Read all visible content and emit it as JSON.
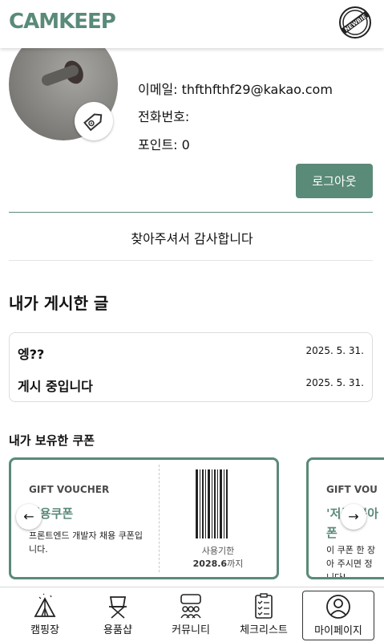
{
  "header": {
    "logo": "CAMKEEP",
    "badge_text": "NEWBIE",
    "badge_icon": "newbie-stamp-icon"
  },
  "profile": {
    "avatar_icon": "cat-paw-photo",
    "edit_icon": "tag-icon",
    "email_label": "이메일: thfthfthf29@kakao.com",
    "phone_label": "전화번호:",
    "points_label": "포인트: 0",
    "logout_label": "로그아웃"
  },
  "thanks": "찾아주셔서 감사합니다",
  "posts": {
    "title": "내가 게시한 글",
    "items": [
      {
        "title": "엥??",
        "date": "2025. 5. 31."
      },
      {
        "title": "게시 중입니다",
        "date": "2025. 5. 31."
      }
    ]
  },
  "coupons": {
    "title": "내가 보유한 쿠폰",
    "items": [
      {
        "label": "GIFT VOUCHER",
        "name": "채용쿠폰",
        "desc": "프론트엔드 개발자 채용 쿠폰입니다.",
        "expire_label": "사용기한",
        "expire_date": "2028.6",
        "expire_suffix": "까지"
      },
      {
        "label": "GIFT VOU",
        "name": "'저를 뽑아",
        "name2": "폰",
        "desc": "이 쿠폰 한 장\n아 주시면 정\n니다!"
      }
    ],
    "prev_icon": "arrow-left-icon",
    "next_icon": "arrow-right-icon"
  },
  "nav": {
    "items": [
      {
        "label": "캠핑장",
        "icon": "tent-icon"
      },
      {
        "label": "용품샵",
        "icon": "camping-chair-icon"
      },
      {
        "label": "커뮤니티",
        "icon": "community-icon"
      },
      {
        "label": "체크리스트",
        "icon": "checklist-icon"
      },
      {
        "label": "마이페이지",
        "icon": "user-icon"
      }
    ],
    "active": "마이페이지"
  },
  "colors": {
    "accent": "#5a8a78"
  }
}
